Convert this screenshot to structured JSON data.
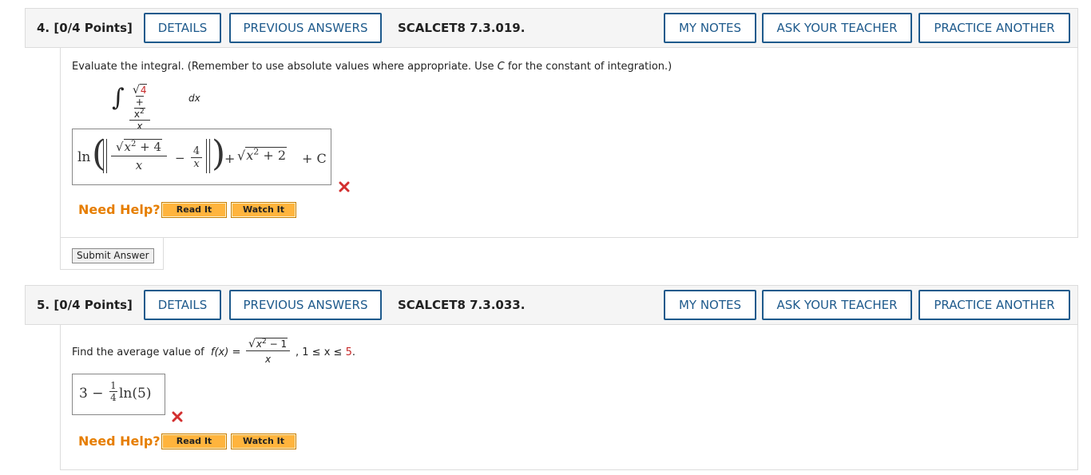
{
  "q4": {
    "number": "4.",
    "points": "[0/4 Points]",
    "details_label": "DETAILS",
    "previous_answers_label": "PREVIOUS ANSWERS",
    "code": "SCALCET8 7.3.019.",
    "my_notes_label": "MY NOTES",
    "ask_teacher_label": "ASK YOUR TEACHER",
    "practice_another_label": "PRACTICE ANOTHER",
    "prompt": "Evaluate the integral. (Remember to use absolute values where appropriate. Use",
    "prompt_var": "C",
    "prompt_end": "for the constant of integration.)",
    "integrand_red": "4",
    "integrand_rest": "+ x",
    "integrand_exp": "2",
    "integrand_den": "x",
    "integrand_dx": "dx",
    "answer": {
      "ln": "ln",
      "sqrt_inner": "x",
      "sqrt_exp": "2",
      "sqrt_rest": "+ 4",
      "den1": "x",
      "minus": "−",
      "num2": "4",
      "den2": "x",
      "plus": "+",
      "sqrt2_inner": "x",
      "sqrt2_exp": "2",
      "sqrt2_rest": "+ 2",
      "const": "+ C"
    },
    "status_icon": "incorrect-x-icon",
    "need_help": "Need Help?",
    "read_it": "Read It",
    "watch_it": "Watch It",
    "submit_label": "Submit Answer"
  },
  "q5": {
    "number": "5.",
    "points": "[0/4 Points]",
    "details_label": "DETAILS",
    "previous_answers_label": "PREVIOUS ANSWERS",
    "code": "SCALCET8 7.3.033.",
    "my_notes_label": "MY NOTES",
    "ask_teacher_label": "ASK YOUR TEACHER",
    "practice_another_label": "PRACTICE ANOTHER",
    "prompt": "Find the average value of",
    "func": "f(x) =",
    "func_num_inner": "x",
    "func_num_exp": "2",
    "func_num_rest": "− 1",
    "func_den": "x",
    "range_start": ", 1 ≤ x ≤",
    "range_red": "5",
    "range_end": ".",
    "answer": {
      "lead": "3 −",
      "num": "1",
      "den": "4",
      "ln": "ln(5)"
    },
    "status_icon": "incorrect-x-icon",
    "need_help": "Need Help?",
    "read_it": "Read It",
    "watch_it": "Watch It"
  },
  "colors": {
    "accent": "#1e5a8c",
    "need_help": "#e67e00",
    "help_button": "#ffb43d",
    "incorrect": "#d32f2f",
    "red_value": "#c62828"
  }
}
